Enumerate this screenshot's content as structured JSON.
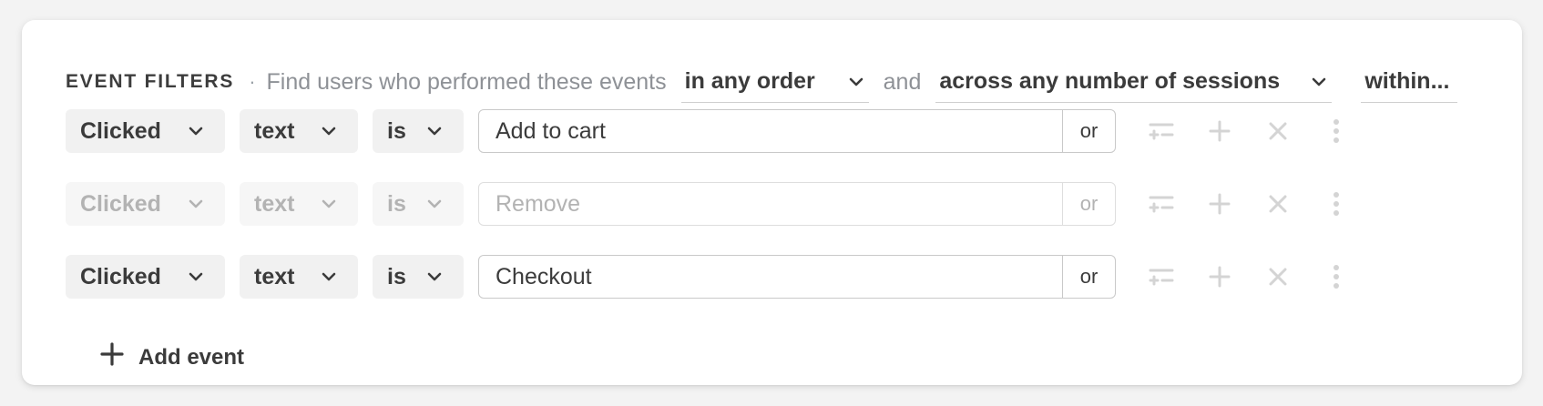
{
  "header": {
    "title": "EVENT FILTERS",
    "separator": "·",
    "description": "Find users who performed these events",
    "order_select": "in any order",
    "conjunction": "and",
    "sessions_select": "across any number of sessions",
    "within_select": "within..."
  },
  "rows": [
    {
      "event": "Clicked",
      "property": "text",
      "operator": "is",
      "value": "Add to cart",
      "or_label": "or",
      "disabled": false
    },
    {
      "event": "Clicked",
      "property": "text",
      "operator": "is",
      "value": "Remove",
      "or_label": "or",
      "disabled": true
    },
    {
      "event": "Clicked",
      "property": "text",
      "operator": "is",
      "value": "Checkout",
      "or_label": "or",
      "disabled": false
    }
  ],
  "add_event_label": "Add event",
  "icons": {
    "chevron": "chevron-down-icon",
    "filter": "add-filter-icon",
    "plus": "plus-icon",
    "close": "close-icon",
    "more": "more-vertical-icon"
  },
  "colors": {
    "text": "#3b3b3b",
    "muted": "#8e9196",
    "disabled_text": "#b3b3b3",
    "icon_muted": "#d4d4d4",
    "pill_bg": "#f1f1f1"
  }
}
